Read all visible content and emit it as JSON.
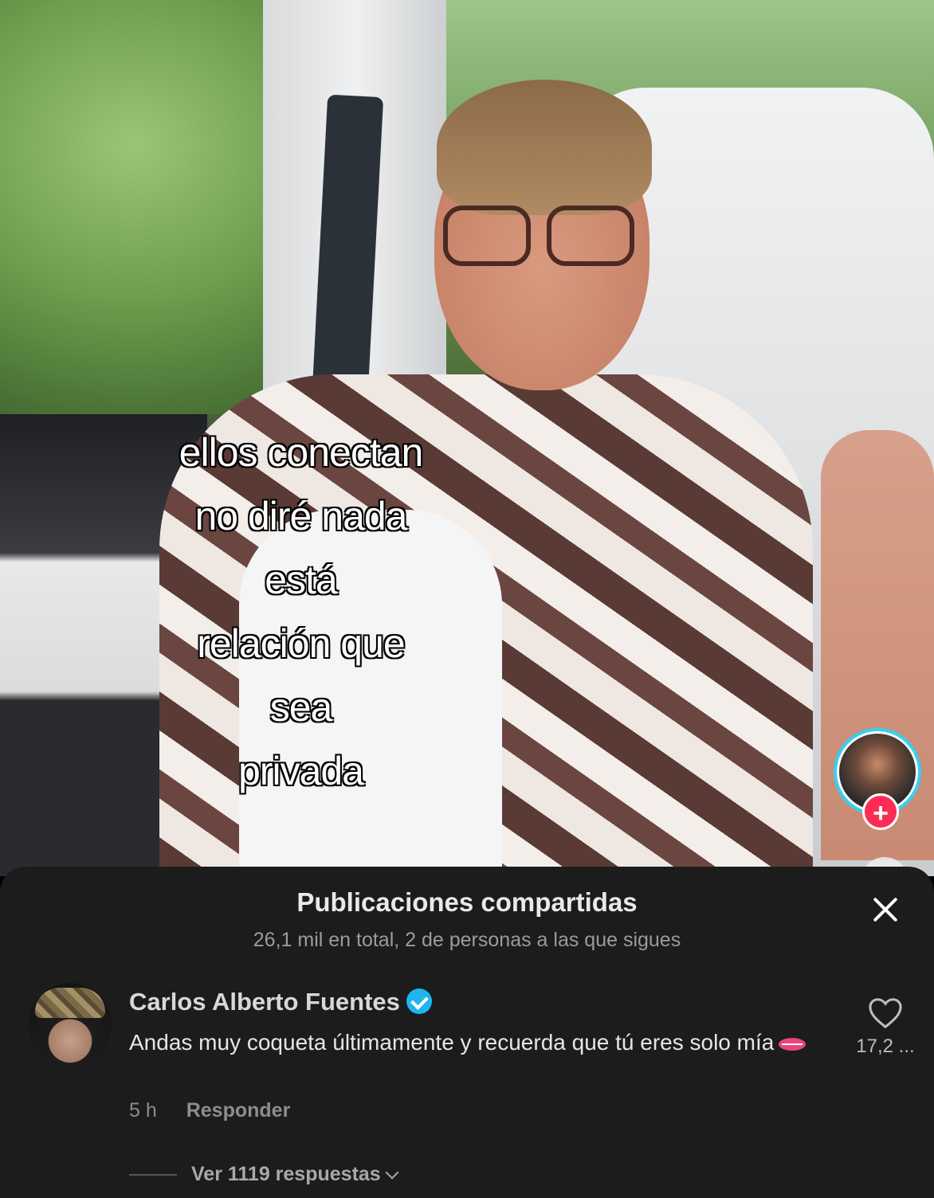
{
  "video": {
    "caption_lines": [
      "ellos conectan",
      "no diré nada",
      "está",
      "relación que",
      "sea",
      "privada"
    ]
  },
  "sheet": {
    "title": "Publicaciones compartidas",
    "subtitle": "26,1 mil en total, 2 de personas a las que sigues"
  },
  "comment": {
    "author": "Carlos Alberto Fuentes",
    "text": "Andas muy coqueta últimamente y recuerda que tú eres solo mía",
    "time": "5 h",
    "reply_label": "Responder",
    "like_count": "17,2 ...",
    "view_replies": "Ver 1119 respuestas"
  },
  "colors": {
    "accent_pink": "#fe2c55",
    "verified_blue": "#20b5f0",
    "sheet_bg": "#1c1c1d"
  }
}
